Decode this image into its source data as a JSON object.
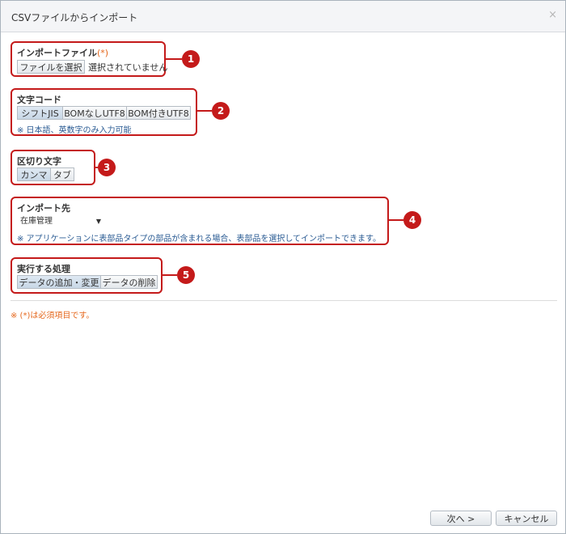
{
  "dialog": {
    "title": "CSVファイルからインポート",
    "close_glyph": "×"
  },
  "sections": {
    "file": {
      "label": "インポートファイル",
      "required_mark": "(*)",
      "choose_button": "ファイルを選択",
      "file_status": "選択されていません",
      "badge": "1"
    },
    "encoding": {
      "label": "文字コード",
      "options": [
        "シフトJIS",
        "BOMなしUTF8",
        "BOM付きUTF8"
      ],
      "selected": "シフトJIS",
      "note": "※ 日本語、英数字のみ入力可能",
      "badge": "2"
    },
    "delimiter": {
      "label": "区切り文字",
      "options": [
        "カンマ",
        "タブ"
      ],
      "selected": "カンマ",
      "badge": "3"
    },
    "destination": {
      "label": "インポート先",
      "select_value": "在庫管理",
      "select_arrow": "▼",
      "note": "※ アプリケーションに表部品タイプの部品が含まれる場合、表部品を選択してインポートできます。",
      "badge": "4"
    },
    "action": {
      "label": "実行する処理",
      "options": [
        "データの追加・変更",
        "データの削除"
      ],
      "selected": "データの追加・変更",
      "badge": "5"
    }
  },
  "footnote": "※ (*)は必須項目です。",
  "footer": {
    "next_button": "次へ >",
    "cancel_button": "キャンセル"
  },
  "colors": {
    "accent_red": "#c41a1a",
    "required_orange": "#e5671c",
    "note_blue": "#2a5b93"
  }
}
